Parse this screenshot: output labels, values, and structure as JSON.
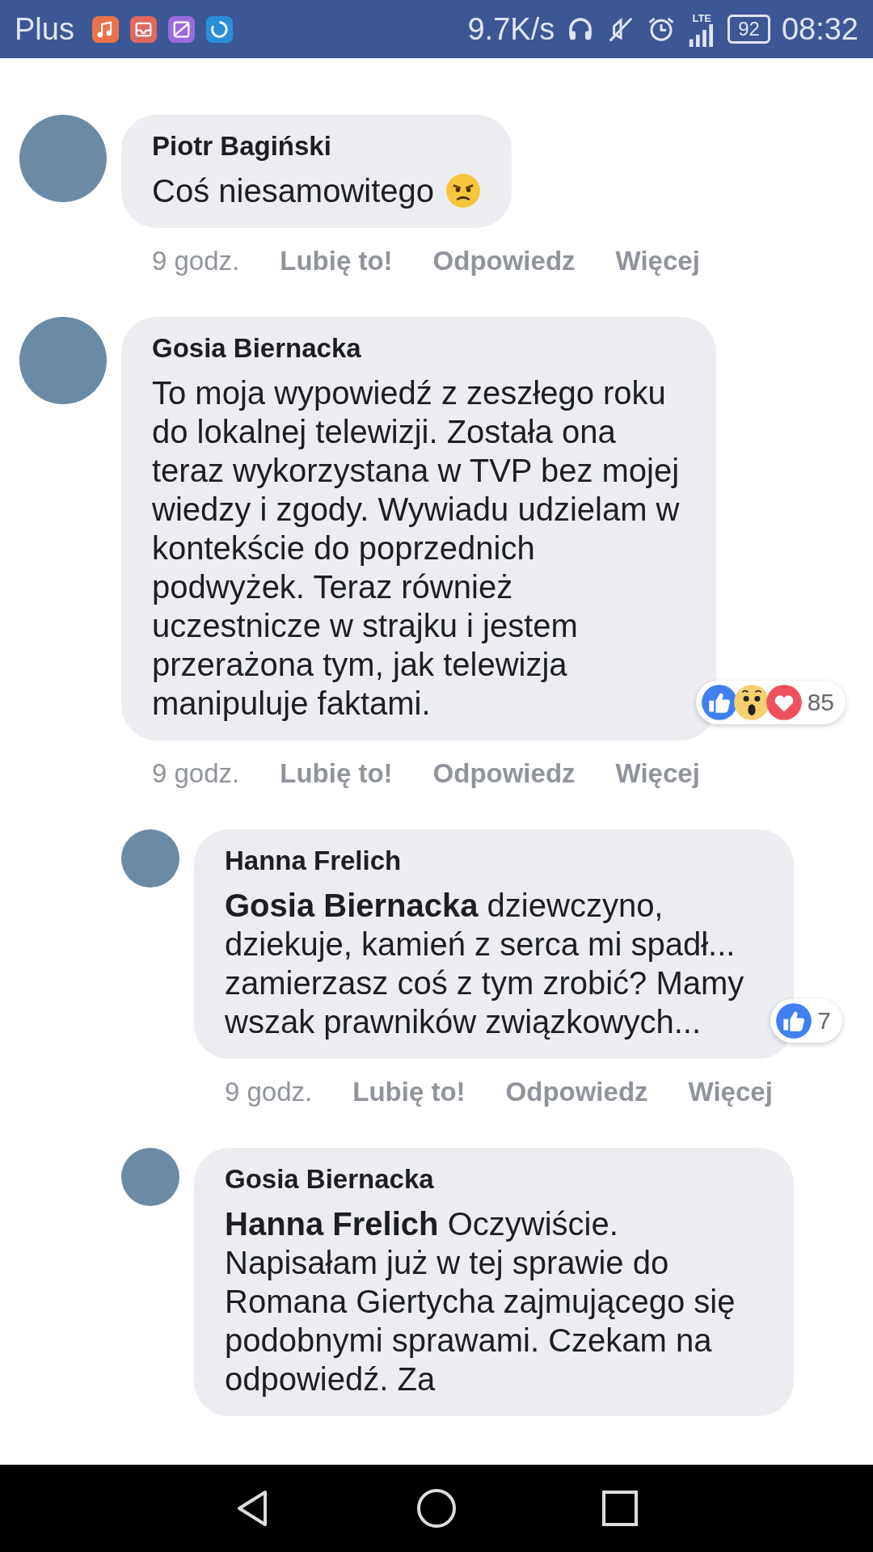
{
  "status_bar": {
    "carrier": "Plus",
    "speed": "9.7K/s",
    "network": "LTE",
    "battery": "92",
    "time": "08:32"
  },
  "comments": [
    {
      "author": "Piotr Bagiński",
      "text": "Coś niesamowitego",
      "emoji": {
        "kind": "angry"
      },
      "reply": false,
      "time": "9 godz.",
      "actions": [
        "Lubię to!",
        "Odpowiedz",
        "Więcej"
      ]
    },
    {
      "author": "Gosia Biernacka",
      "text": "To moja wypowiedź z zeszłego roku do lokalnej telewizji. Została ona teraz wykorzystana w TVP bez mojej wiedzy i zgody. Wywiadu udzielam w kontekście do poprzednich podwyżek. Teraz również uczestnicze w strajku i jestem przerażona tym, jak telewizja manipuluje faktami.",
      "reply": false,
      "reactions": {
        "icons": [
          {
            "kind": "like"
          },
          {
            "kind": "wow"
          },
          {
            "kind": "love"
          }
        ],
        "count": "85"
      },
      "time": "9 godz.",
      "actions": [
        "Lubię to!",
        "Odpowiedz",
        "Więcej"
      ]
    },
    {
      "author": "Hanna Frelich",
      "text": "**Gosia Biernacka** dziewczyno, dziekuje, kamień z serca mi spadł... zamierzasz coś z tym zrobić? Mamy wszak prawników związkowych...",
      "reply": true,
      "reactions": {
        "icons": [
          {
            "kind": "like"
          }
        ],
        "count": "7"
      },
      "time": "9 godz.",
      "actions": [
        "Lubię to!",
        "Odpowiedz",
        "Więcej"
      ]
    },
    {
      "author": "Gosia Biernacka",
      "text": "**Hanna Frelich** Oczywiście. Napisałam już w tej sprawie do Romana Giertycha zajmującego się podobnymi sprawami. Czekam na odpowiedź. Za",
      "reply": true
    }
  ]
}
